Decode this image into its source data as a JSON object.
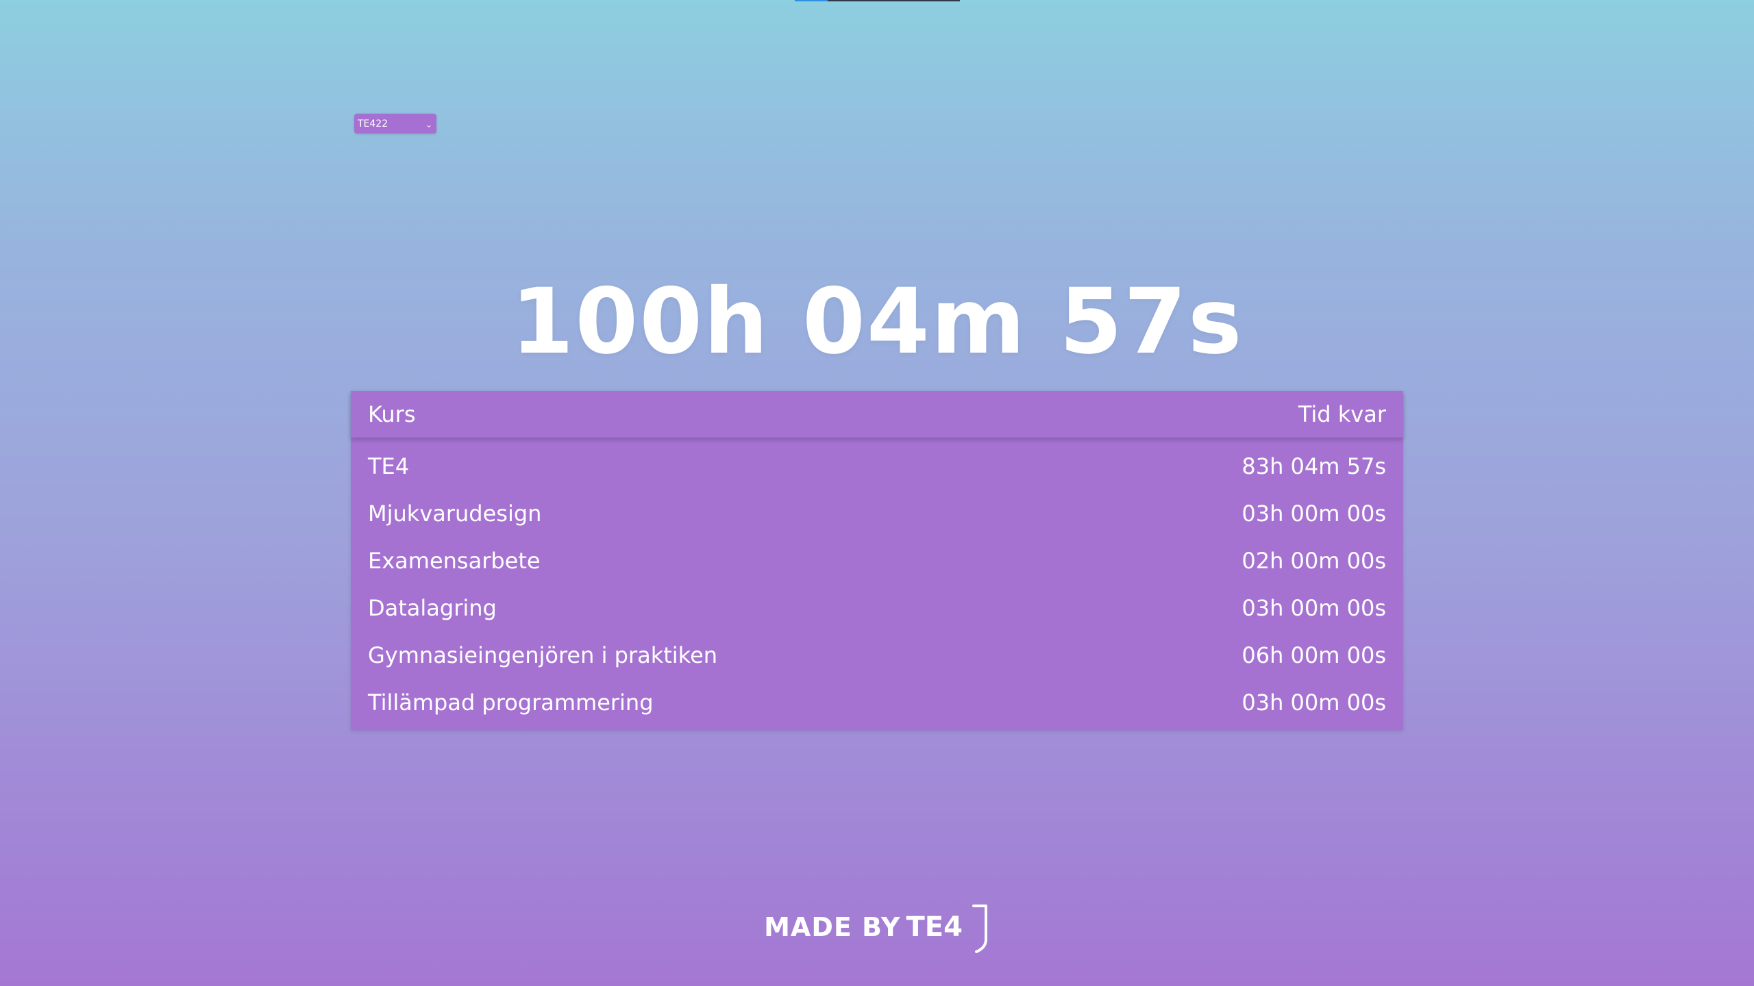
{
  "top_progress": {
    "fraction": 0.2
  },
  "class_selector": {
    "selected": "TE422",
    "icon": "chevron-down-icon"
  },
  "countdown": {
    "total": "100h 04m 57s"
  },
  "course_table": {
    "header": {
      "course": "Kurs",
      "time_left": "Tid kvar"
    },
    "rows": [
      {
        "course": "TE4",
        "time_left": "83h 04m 57s"
      },
      {
        "course": "Mjukvarudesign",
        "time_left": "03h 00m 00s"
      },
      {
        "course": "Examensarbete",
        "time_left": "02h 00m 00s"
      },
      {
        "course": "Datalagring",
        "time_left": "03h 00m 00s"
      },
      {
        "course": "Gymnasieingenjören i praktiken",
        "time_left": "06h 00m 00s"
      },
      {
        "course": "Tillämpad programmering",
        "time_left": "03h 00m 00s"
      }
    ]
  },
  "footer": {
    "made_by": "MADE BY",
    "brand": "TE4"
  },
  "colors": {
    "accent": "#a672d2",
    "gradient_top": "#8dcee0",
    "gradient_bottom": "#a477d3",
    "text": "#ffffff"
  }
}
